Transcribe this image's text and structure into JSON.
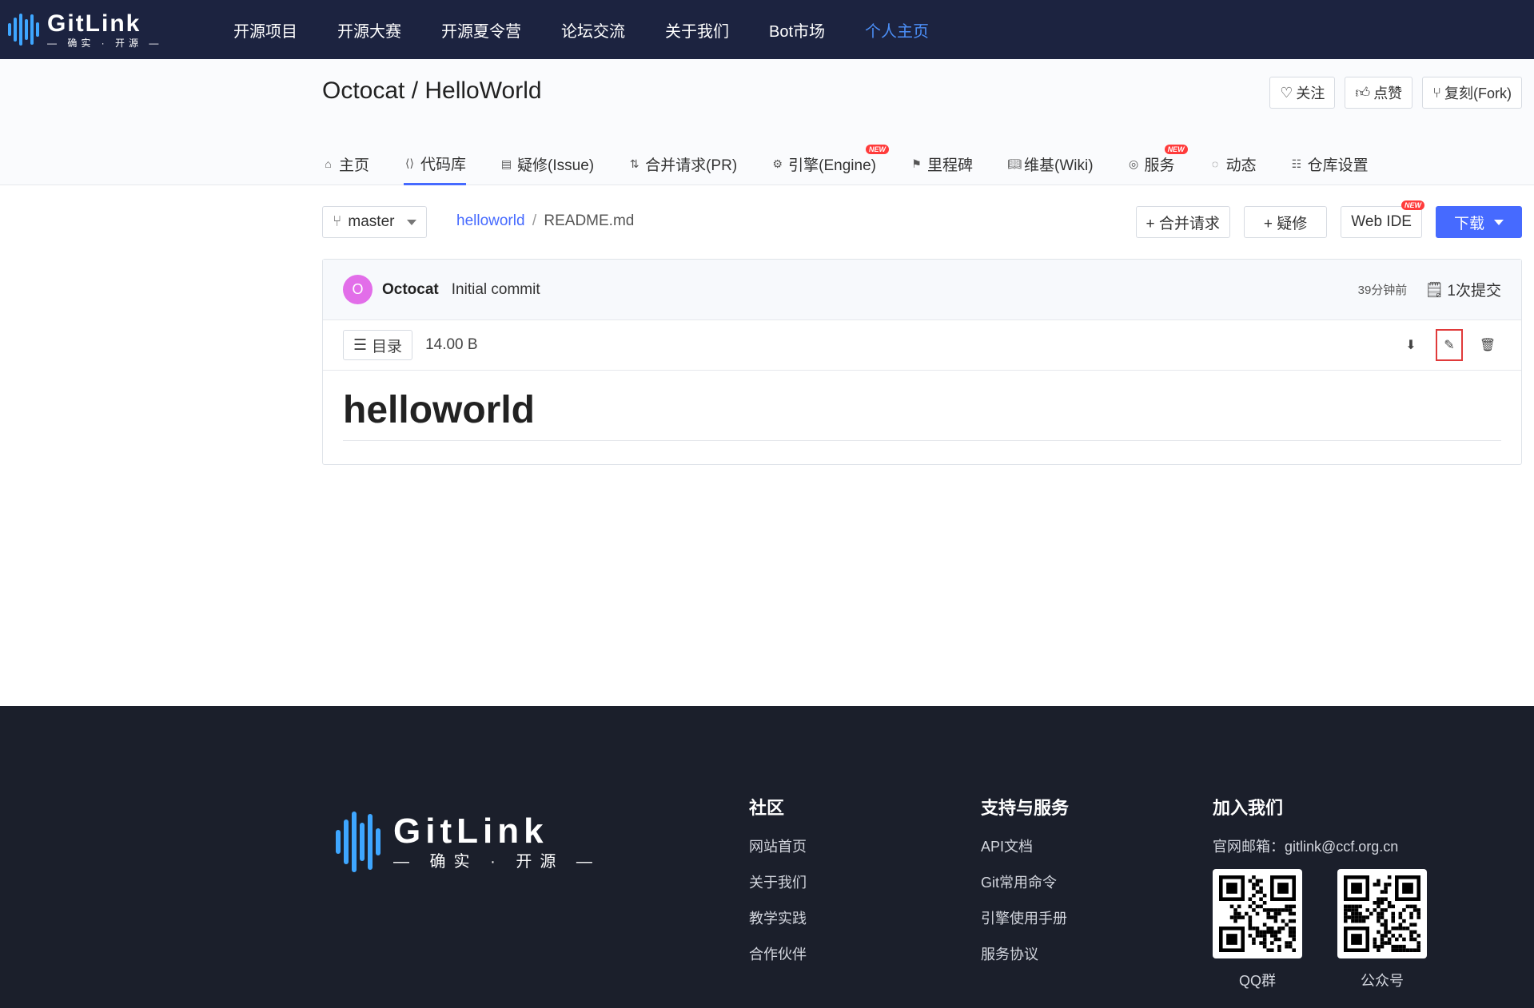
{
  "brand": {
    "name": "GitLink",
    "tagline": "— 确实 · 开源 —"
  },
  "nav": [
    {
      "label": "开源项目"
    },
    {
      "label": "开源大赛"
    },
    {
      "label": "开源夏令营"
    },
    {
      "label": "论坛交流"
    },
    {
      "label": "关于我们"
    },
    {
      "label": "Bot市场"
    },
    {
      "label": "个人主页",
      "active": true
    }
  ],
  "repo": {
    "title": "Octocat / HelloWorld",
    "actions": {
      "watch": "关注",
      "star": "点赞",
      "fork": "复刻(Fork)"
    }
  },
  "tabs": [
    {
      "label": "主页",
      "icon": "home-icon"
    },
    {
      "label": "代码库",
      "icon": "code-icon",
      "active": true
    },
    {
      "label": "疑修(Issue)",
      "icon": "issue-icon"
    },
    {
      "label": "合并请求(PR)",
      "icon": "pull-request-icon"
    },
    {
      "label": "引擎(Engine)",
      "icon": "engine-icon",
      "badge": "NEW"
    },
    {
      "label": "里程碑",
      "icon": "flag-icon"
    },
    {
      "label": "维基(Wiki)",
      "icon": "book-icon"
    },
    {
      "label": "服务",
      "icon": "service-icon",
      "badge": "NEW"
    },
    {
      "label": "动态",
      "icon": "activity-icon"
    },
    {
      "label": "仓库设置",
      "icon": "settings-icon"
    }
  ],
  "toolbar": {
    "branch": "master",
    "breadcrumb_root": "helloworld",
    "breadcrumb_sep": "/",
    "breadcrumb_file": "README.md",
    "new_pr": "+ 合并请求",
    "new_issue": "+ 疑修",
    "web_ide": "Web IDE",
    "web_ide_badge": "NEW",
    "download": "下载"
  },
  "commit": {
    "avatar_letter": "O",
    "avatar_color": "#e26ee9",
    "author": "Octocat",
    "message": "Initial commit",
    "time": "39分钟前",
    "count": "1次提交"
  },
  "file": {
    "toc": "目录",
    "size": "14.00 B",
    "heading": "helloworld"
  },
  "footer": {
    "community": {
      "title": "社区",
      "links": [
        "网站首页",
        "关于我们",
        "教学实践",
        "合作伙伴"
      ]
    },
    "support": {
      "title": "支持与服务",
      "links": [
        "API文档",
        "Git常用命令",
        "引擎使用手册",
        "服务协议"
      ]
    },
    "join": {
      "title": "加入我们",
      "email": "官网邮箱：gitlink@ccf.org.cn",
      "qr_qq": "QQ群",
      "qr_wechat": "公众号"
    }
  },
  "colors": {
    "nav_bg": "#1c2340",
    "accent": "#466aff",
    "nav_active": "#4b8ef6",
    "footer_bg": "#1b1f2b",
    "highlight": "#e03a3a"
  }
}
